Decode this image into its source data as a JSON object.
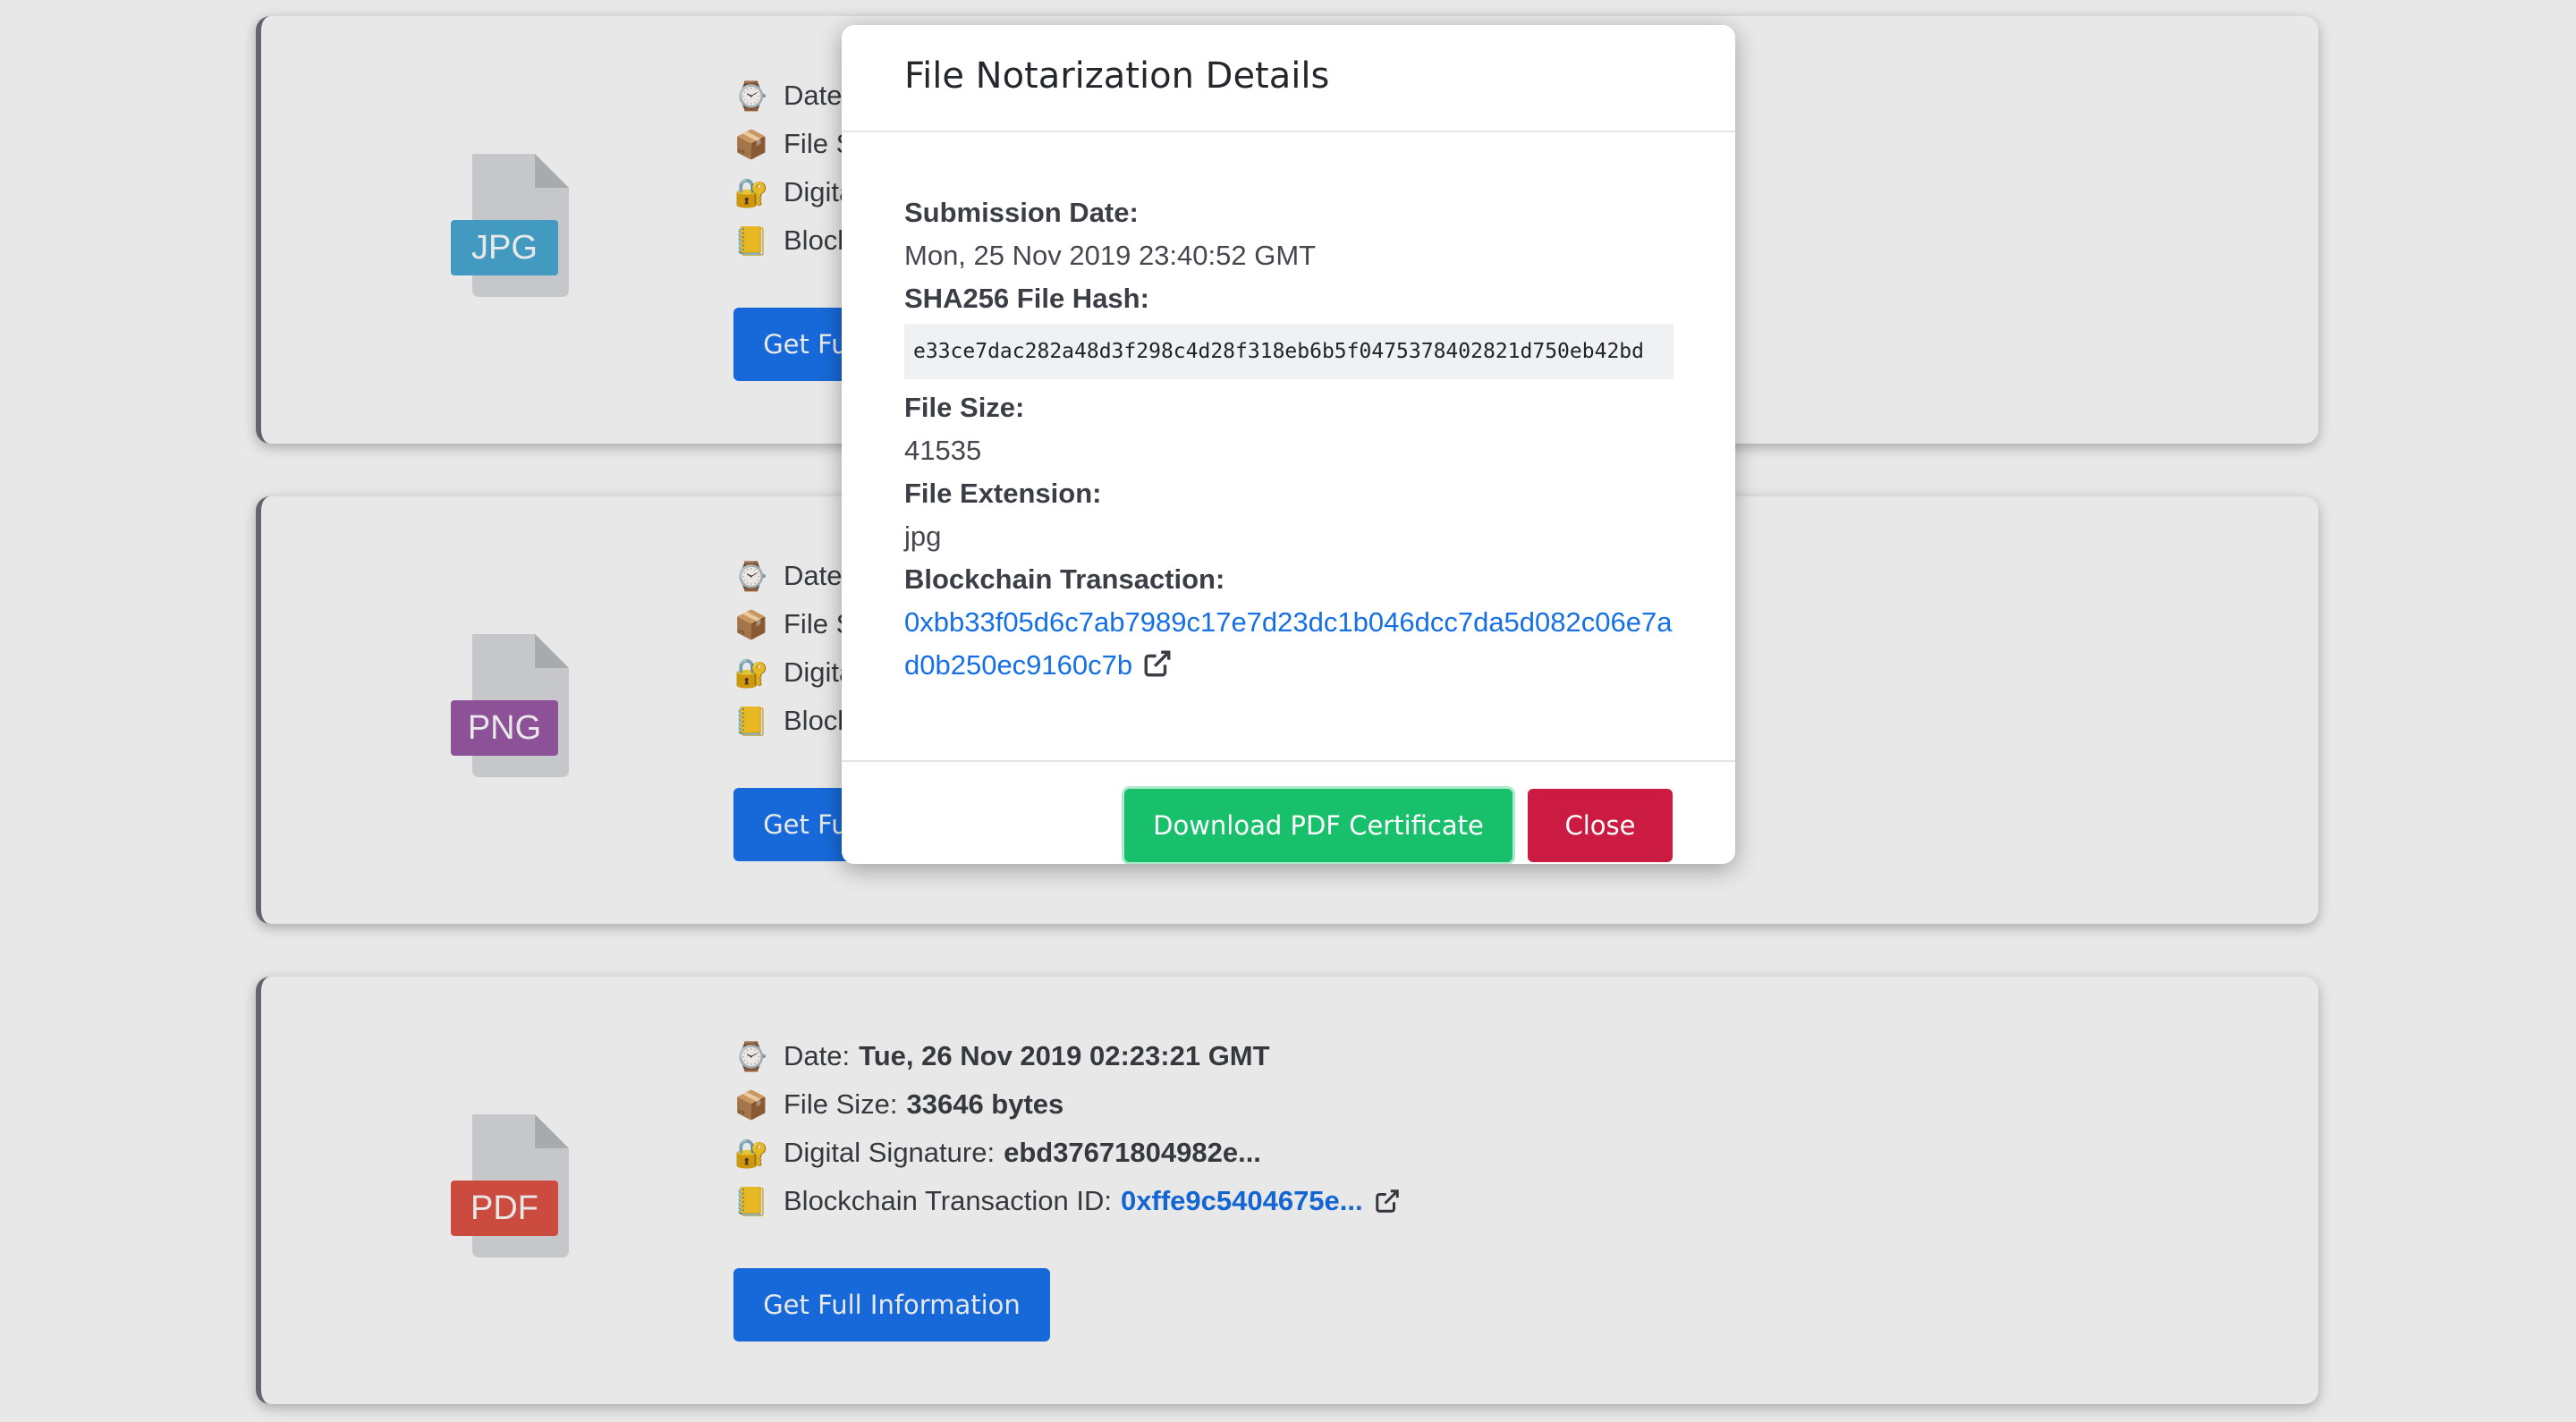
{
  "cards": [
    {
      "file_type": "JPG",
      "badge_color": "#4aaad3",
      "date_label": "Date:",
      "date_value": "",
      "size_label": "File Size:",
      "size_value": "",
      "signature_label": "Digital Signature:",
      "signature_value": "",
      "tx_label": "Blockchain Transaction ID:",
      "tx_value": "",
      "button_label": "Get Full Information"
    },
    {
      "file_type": "PNG",
      "badge_color": "#9b59a6",
      "date_label": "Date:",
      "date_value": "",
      "size_label": "File Size:",
      "size_value": "",
      "signature_label": "Digital Signature:",
      "signature_value": "",
      "tx_label": "Blockchain Transaction ID:",
      "tx_value": "",
      "button_label": "Get Full Information"
    },
    {
      "file_type": "PDF",
      "badge_color": "#e05346",
      "date_label": "Date:",
      "date_value": "Tue, 26 Nov 2019 02:23:21 GMT",
      "size_label": "File Size:",
      "size_value": "33646 bytes",
      "signature_label": "Digital Signature:",
      "signature_value": "ebd37671804982e...",
      "tx_label": "Blockchain Transaction ID:",
      "tx_value": "0xffe9c5404675e...",
      "button_label": "Get Full Information"
    }
  ],
  "modal": {
    "title": "File Notarization Details",
    "submission_date_label": "Submission Date:",
    "submission_date": "Mon, 25 Nov 2019 23:40:52 GMT",
    "hash_label": "SHA256 File Hash:",
    "hash": "e33ce7dac282a48d3f298c4d28f318eb6b5f0475378402821d750eb42bd",
    "size_label": "File Size:",
    "size": "41535",
    "extension_label": "File Extension:",
    "extension": "jpg",
    "tx_label": "Blockchain Transaction:",
    "tx": "0xbb33f05d6c7ab7989c17e7d23dc1b046dcc7da5d082c06e7ad0b250ec9160c7b",
    "download_label": "Download PDF Certificate",
    "close_label": "Close"
  },
  "icons": {
    "date": "watch-icon",
    "size": "package-icon",
    "signature": "lock-key-icon",
    "tx": "ledger-icon",
    "external": "external-link-icon"
  }
}
